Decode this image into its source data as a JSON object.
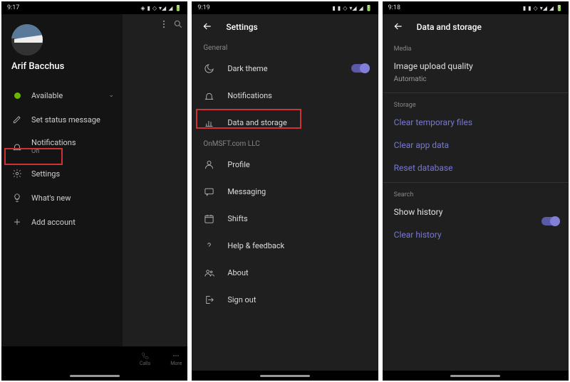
{
  "screen1": {
    "time": "9:17",
    "status_icons": [
      "◈",
      "▮",
      "◇",
      "▾◢",
      "◢",
      "🔋"
    ],
    "username": "Arif Bacchus",
    "presence_label": "Available",
    "menu": {
      "set_status": "Set status message",
      "notifications": "Notifications",
      "notifications_sub": "On",
      "settings": "Settings",
      "whats_new": "What's new",
      "add_account": "Add account"
    },
    "nav": {
      "calls": "Calls",
      "more": "More"
    }
  },
  "screen2": {
    "time": "9:19",
    "status_icons": [
      "▮",
      "▮",
      "◇",
      "▾◢",
      "◢",
      "🔋"
    ],
    "header": "Settings",
    "section_general": "General",
    "dark_theme": "Dark theme",
    "notifications": "Notifications",
    "data_storage": "Data and storage",
    "section_org": "OnMSFT.com LLC",
    "profile": "Profile",
    "messaging": "Messaging",
    "shifts": "Shifts",
    "help": "Help & feedback",
    "about": "About",
    "sign_out": "Sign out"
  },
  "screen3": {
    "time": "9:18",
    "status_icons": [
      "▮",
      "▮",
      "◇",
      "▾◢",
      "◢",
      "🔋"
    ],
    "header": "Data and storage",
    "section_media": "Media",
    "upload_quality": "Image upload quality",
    "upload_quality_sub": "Automatic",
    "section_storage": "Storage",
    "clear_temp": "Clear temporary files",
    "clear_app": "Clear app data",
    "reset_db": "Reset database",
    "section_search": "Search",
    "show_history": "Show history",
    "clear_history": "Clear history"
  }
}
